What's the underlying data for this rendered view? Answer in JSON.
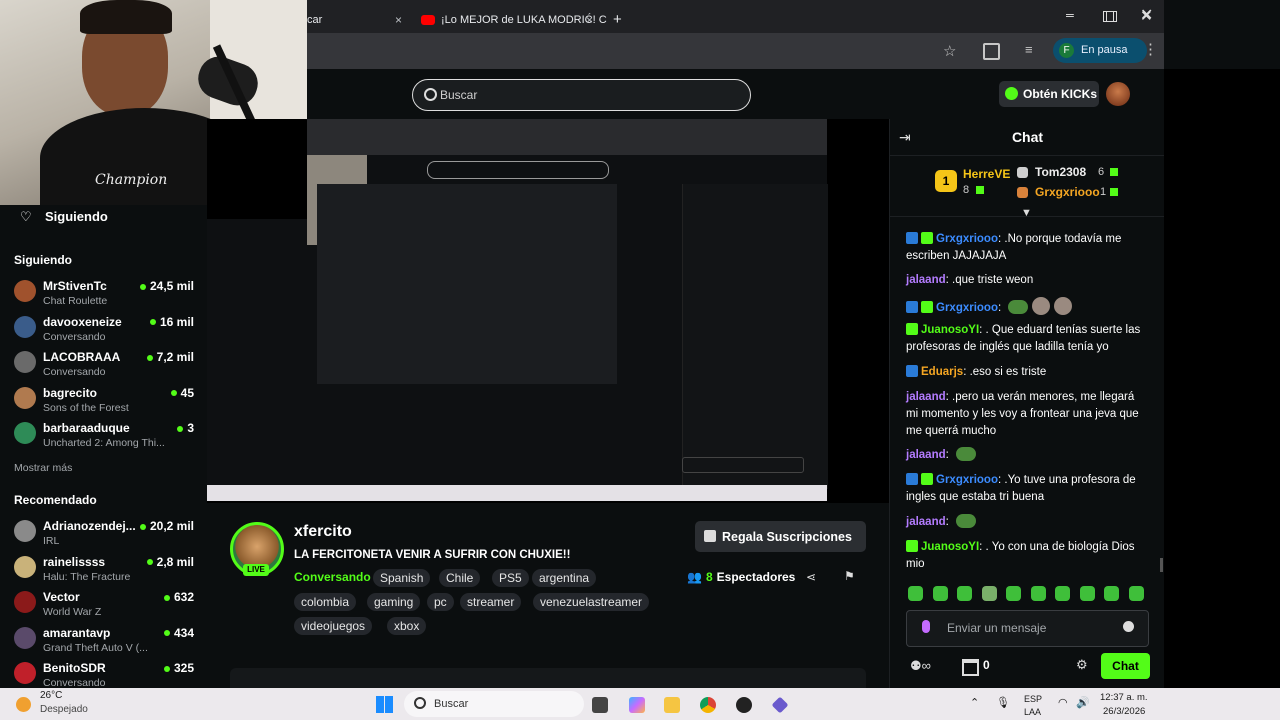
{
  "browser": {
    "tab1_title": "car",
    "tab2_title": "¡Lo MEJOR de LUKA MODRIĆ! C",
    "profile_label": "En pausa",
    "profile_initial": "F",
    "new_tab": "+",
    "close_tab": "×"
  },
  "kick_header": {
    "search_placeholder": "Buscar",
    "kicks_button": "Obtén KICKs"
  },
  "sidebar": {
    "following_title": "Siguiendo",
    "section_following": "Siguiendo",
    "following": [
      {
        "name": "MrStivenTc",
        "category": "Chat Roulette",
        "viewers": "24,5 mil",
        "color": "#a0522d"
      },
      {
        "name": "davooxeneize",
        "category": "Conversando",
        "viewers": "16 mil",
        "color": "#3a5c8a"
      },
      {
        "name": "LACOBRAAA",
        "category": "Conversando",
        "viewers": "7,2 mil",
        "color": "#6a6a6a"
      },
      {
        "name": "bagrecito",
        "category": "Sons of the Forest",
        "viewers": "45",
        "color": "#b07a4f"
      },
      {
        "name": "barbaraaduque",
        "category": "Uncharted 2: Among Thi...",
        "viewers": "3",
        "color": "#2e8b57"
      }
    ],
    "show_more": "Mostrar más",
    "section_recommended": "Recomendado",
    "recommended": [
      {
        "name": "Adrianozendej...",
        "category": "IRL",
        "viewers": "20,2 mil",
        "color": "#8a8a8a"
      },
      {
        "name": "rainelissss",
        "category": "Halu: The Fracture",
        "viewers": "2,8 mil",
        "color": "#c9b27a"
      },
      {
        "name": "Vector",
        "category": "World War Z",
        "viewers": "632",
        "color": "#8b1a1a"
      },
      {
        "name": "amarantavp",
        "category": "Grand Theft Auto V (...",
        "viewers": "434",
        "color": "#5a4a6a"
      },
      {
        "name": "BenitoSDR",
        "category": "Conversando",
        "viewers": "325",
        "color": "#c0202a"
      }
    ]
  },
  "stream": {
    "channel": "xfercito",
    "title": "LA FERCITONETA VENIR A SUFRIR CON CHUXIE!!",
    "live_badge": "LIVE",
    "category": "Conversando",
    "tags_row1": [
      "Spanish",
      "Chile",
      "PS5",
      "argentina"
    ],
    "tags_row2": [
      "colombia",
      "gaming",
      "pc",
      "streamer",
      "venezuelastreamer"
    ],
    "tags_row3": [
      "videojuegos",
      "xbox"
    ],
    "gift_button": "Regala Suscripciones",
    "viewers_count": "8",
    "viewers_label": "Espectadores"
  },
  "chat": {
    "title": "Chat",
    "leaderboard": {
      "first_rank": "1",
      "first_name": "HerreVE",
      "first_value": "8",
      "second_name": "Tom2308",
      "second_value": "6",
      "third_name": "Grxgxriooo",
      "third_value": "1"
    },
    "messages": [
      {
        "user": "Grxgxriooo",
        "text": ".No porque todavía me escriben JAJAJAJA",
        "style": "u-blue",
        "badges": [
          "bb",
          "bg"
        ]
      },
      {
        "user": "jalaand",
        "text": ".que triste weon",
        "style": "u-purple",
        "badges": []
      },
      {
        "user": "Grxgxriooo",
        "text": "",
        "style": "u-blue",
        "badges": [
          "bb",
          "bg"
        ]
      },
      {
        "user": "JuanosoYI",
        "text": ". Que eduard tenías suerte las profesoras de inglés que ladilla tenía yo",
        "style": "u-green",
        "badges": [
          "bg"
        ]
      },
      {
        "user": "Eduarjs",
        "text": ".eso si es triste",
        "style": "u-orange",
        "badges": [
          "bb"
        ]
      },
      {
        "user": "jalaand",
        "text": ".pero ua verán menores, me llegará mi momento y les voy a frontear una jeva que me querrá mucho",
        "style": "u-purple",
        "badges": []
      },
      {
        "user": "jalaand",
        "text": "",
        "style": "u-purple",
        "badges": []
      },
      {
        "user": "Grxgxriooo",
        "text": ".Yo tuve una profesora de ingles que estaba tri buena",
        "style": "u-blue",
        "badges": [
          "bb",
          "bg"
        ]
      },
      {
        "user": "jalaand",
        "text": "",
        "style": "u-purple",
        "badges": []
      },
      {
        "user": "JuanosoYI",
        "text": ". Yo con una de biología Dios mio",
        "style": "u-green",
        "badges": [
          "bg"
        ]
      }
    ],
    "input_placeholder": "Enviar un mensaje",
    "points": "0",
    "send_button": "Chat"
  },
  "taskbar": {
    "weather_temp": "26°C",
    "weather_desc": "Despejado",
    "search_label": "Buscar",
    "lang_top": "ESP",
    "lang_bottom": "LAA",
    "time": "12:37 a. m.",
    "date": "26/3/2026"
  },
  "colors": {
    "accent": "#53fc18",
    "bg": "#0b0e0f",
    "tag": "#24272c"
  }
}
